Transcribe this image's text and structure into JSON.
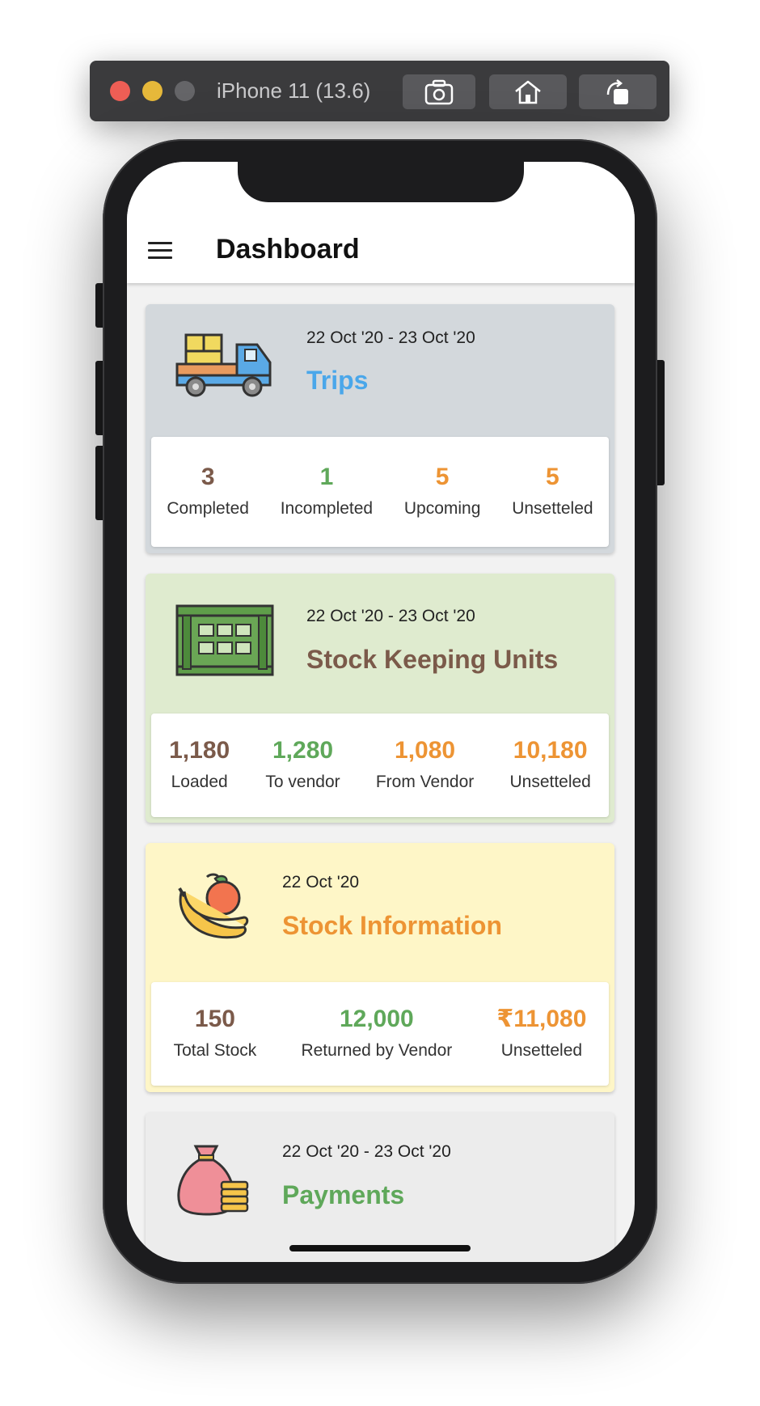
{
  "simulator": {
    "title": "iPhone 11 (13.6)",
    "buttons": [
      "screenshot-icon",
      "home-icon",
      "rotate-icon"
    ]
  },
  "appbar": {
    "title": "Dashboard",
    "menu_icon": "menu-icon"
  },
  "colors": {
    "brown": "#7b5a4a",
    "green": "#5fa85a",
    "orange": "#ed9434",
    "blue": "#4aa7ea"
  },
  "cards": [
    {
      "icon": "truck-icon",
      "date": "22 Oct '20 - 23 Oct '20",
      "title": "Trips",
      "title_color": "#4aa7ea",
      "bg": "#d3d8dc",
      "stats": [
        {
          "value": "3",
          "label": "Completed",
          "color": "#7b5a4a"
        },
        {
          "value": "1",
          "label": "Incompleted",
          "color": "#5fa85a"
        },
        {
          "value": "5",
          "label": "Upcoming",
          "color": "#ed9434"
        },
        {
          "value": "5",
          "label": "Unsetteled",
          "color": "#ed9434"
        }
      ]
    },
    {
      "icon": "crate-icon",
      "date": "22 Oct '20 - 23 Oct '20",
      "title": "Stock Keeping Units",
      "title_color": "#7b5a4a",
      "bg": "#dfebcf",
      "stats": [
        {
          "value": "1,180",
          "label": "Loaded",
          "color": "#7b5a4a"
        },
        {
          "value": "1,280",
          "label": "To vendor",
          "color": "#5fa85a"
        },
        {
          "value": "1,080",
          "label": "From Vendor",
          "color": "#ed9434"
        },
        {
          "value": "10,180",
          "label": "Unsetteled",
          "color": "#ed9434"
        }
      ]
    },
    {
      "icon": "fruit-icon",
      "date": "22 Oct '20",
      "title": "Stock Information",
      "title_color": "#ed9434",
      "bg": "#fef6c7",
      "stats": [
        {
          "value": "150",
          "label": "Total Stock",
          "color": "#7b5a4a"
        },
        {
          "value": "12,000",
          "label": "Returned by Vendor",
          "color": "#5fa85a"
        },
        {
          "value": "₹11,080",
          "label": "Unsetteled",
          "color": "#ed9434"
        }
      ]
    },
    {
      "icon": "money-bag-icon",
      "date": "22 Oct '20 - 23 Oct '20",
      "title": "Payments",
      "title_color": "#5fa85a",
      "bg": "#ececec"
    }
  ]
}
